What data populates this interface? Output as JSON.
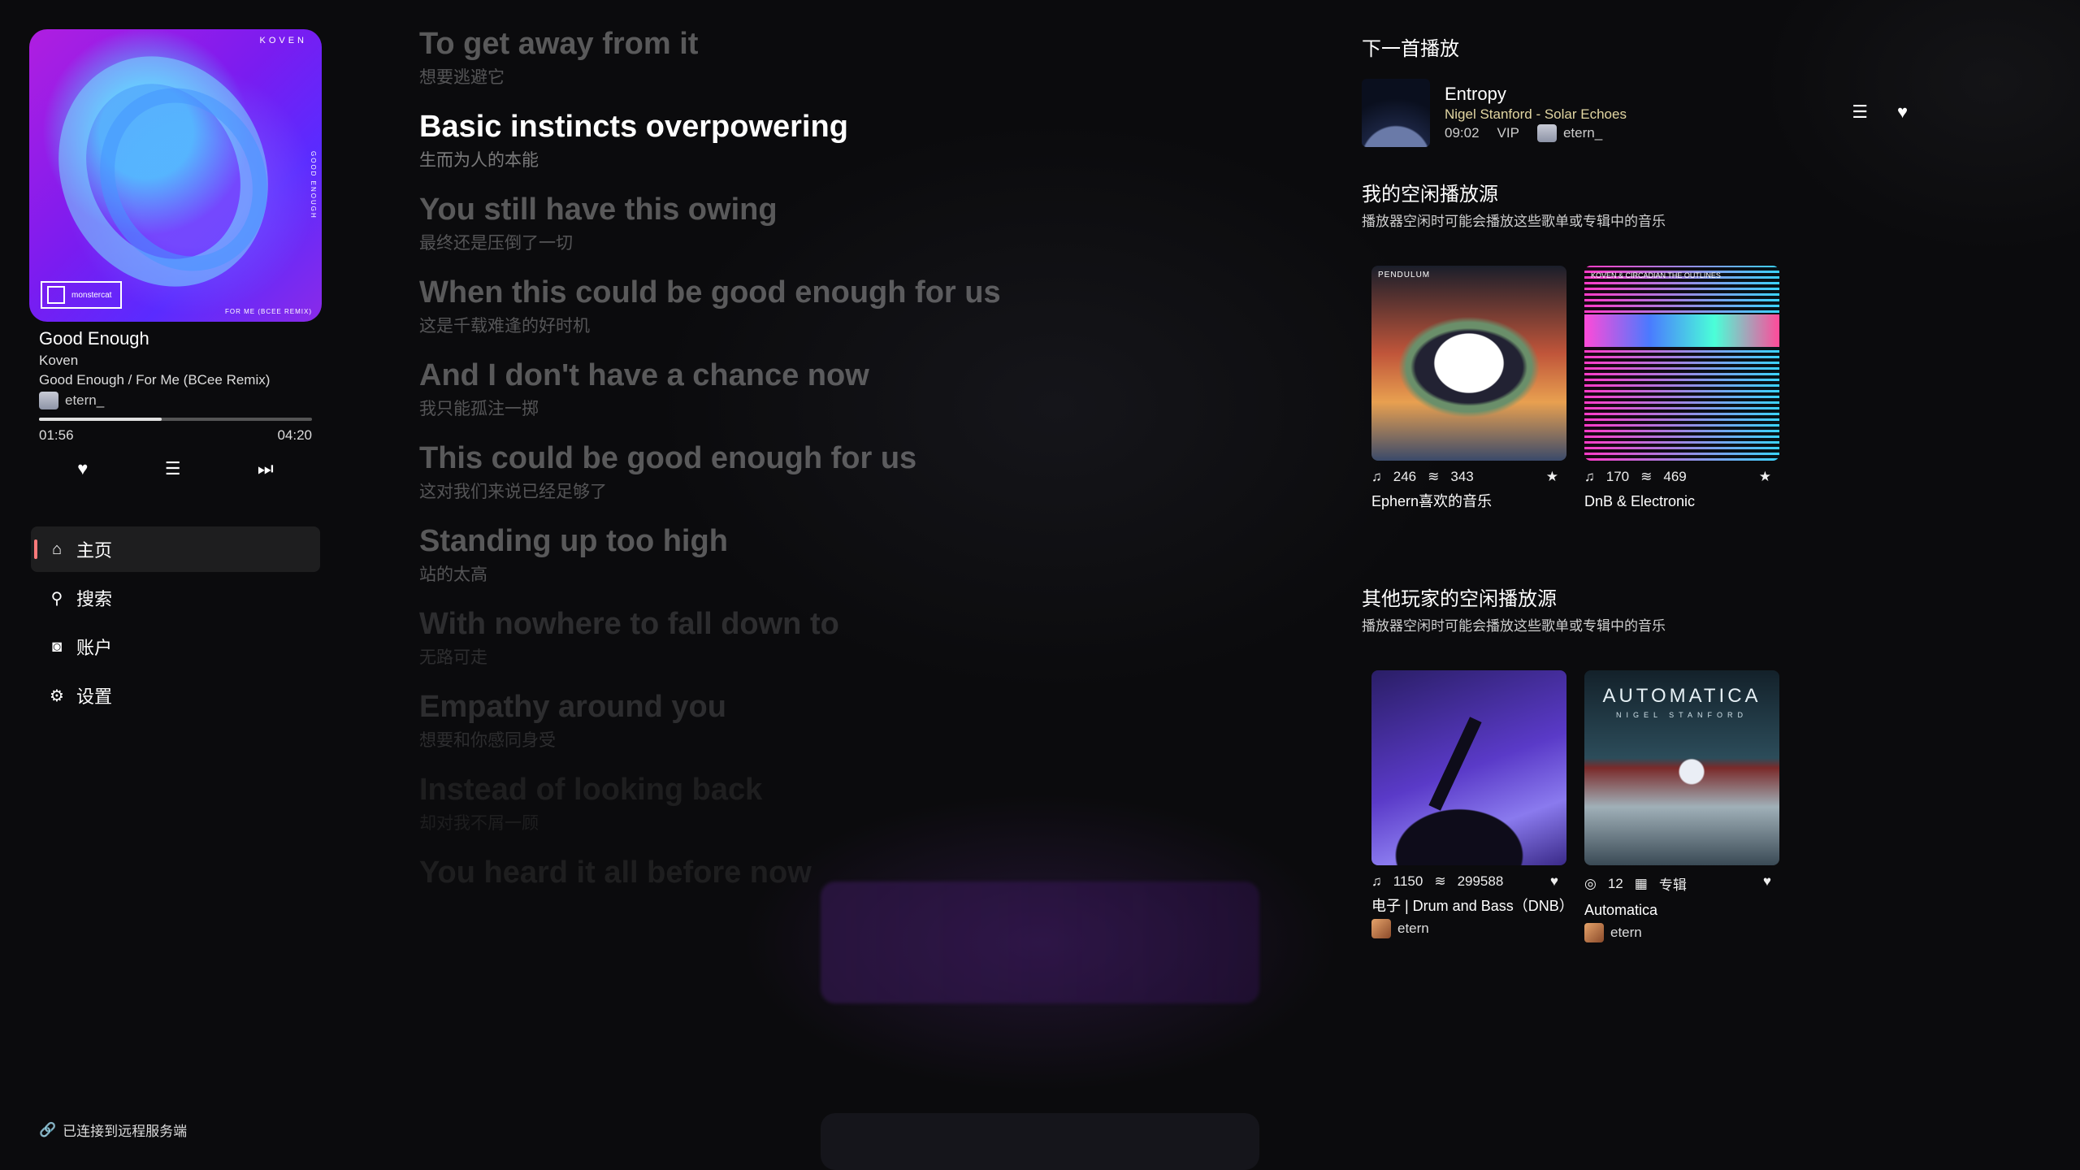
{
  "now_playing": {
    "cover_brand": "KOVEN",
    "cover_badge": "monstercat",
    "cover_sub": "FOR ME (BCEE REMIX)",
    "cover_side": "GOOD ENOUGH",
    "title": "Good Enough",
    "artist": "Koven",
    "album": "Good Enough / For Me (BCee Remix)",
    "user": "etern_",
    "current_time": "01:56",
    "total_time": "04:20",
    "progress": 0.45
  },
  "nav": {
    "home": "主页",
    "search": "搜索",
    "account": "账户",
    "settings": "设置"
  },
  "remote_status": "已连接到远程服务端",
  "lyrics": [
    {
      "en": "To get away from it",
      "zh": "想要逃避它",
      "state": "past"
    },
    {
      "en": "Basic instincts overpowering",
      "zh": "生而为人的本能",
      "state": "active"
    },
    {
      "en": "You still have this owing",
      "zh": "最终还是压倒了一切",
      "state": "next"
    },
    {
      "en": "When this could be good enough for us",
      "zh": "这是千载难逢的好时机",
      "state": "next"
    },
    {
      "en": "And I don't have a chance now",
      "zh": "我只能孤注一掷",
      "state": "next"
    },
    {
      "en": "This could be good enough for us",
      "zh": "这对我们来说已经足够了",
      "state": "next"
    },
    {
      "en": "Standing up too high",
      "zh": "站的太高",
      "state": "next"
    },
    {
      "en": "With nowhere to fall down to",
      "zh": "无路可走",
      "state": "fade"
    },
    {
      "en": "Empathy around you",
      "zh": "想要和你感同身受",
      "state": "fade"
    },
    {
      "en": "Instead of looking back",
      "zh": "却对我不屑一顾",
      "state": "fade2"
    },
    {
      "en": "You heard it all before now",
      "zh": "",
      "state": "fade2"
    }
  ],
  "up_next": {
    "heading": "下一首播放",
    "title": "Entropy",
    "artist": "Nigel Stanford - Solar Echoes",
    "duration": "09:02",
    "quality": "VIP",
    "user": "etern_"
  },
  "my_sources": {
    "heading": "我的空闲播放源",
    "subheading": "播放器空闲时可能会播放这些歌单或专辑中的音乐",
    "items": [
      {
        "cover_label": "PENDULUM",
        "songs": "246",
        "plays": "343",
        "name": "Ephern喜欢的音乐"
      },
      {
        "cover_label": "KOVEN & CIRCADIAN THE OUTLINES",
        "songs": "170",
        "plays": "469",
        "name": "DnB & Electronic"
      }
    ]
  },
  "other_sources": {
    "heading": "其他玩家的空闲播放源",
    "subheading": "播放器空闲时可能会播放这些歌单或专辑中的音乐",
    "items": [
      {
        "songs": "1150",
        "plays": "299588",
        "name": "电子 | Drum and Bass（DNB）",
        "user": "etern"
      },
      {
        "cover_title": "AUTOMATICA",
        "cover_sub": "NIGEL STANFORD",
        "songs": "12",
        "kind": "专辑",
        "name": "Automatica",
        "user": "etern"
      }
    ]
  },
  "colors": {
    "accent": "#ff7b7b",
    "artist_gold": "#e2d6a2",
    "background": "#0b0b0d"
  }
}
